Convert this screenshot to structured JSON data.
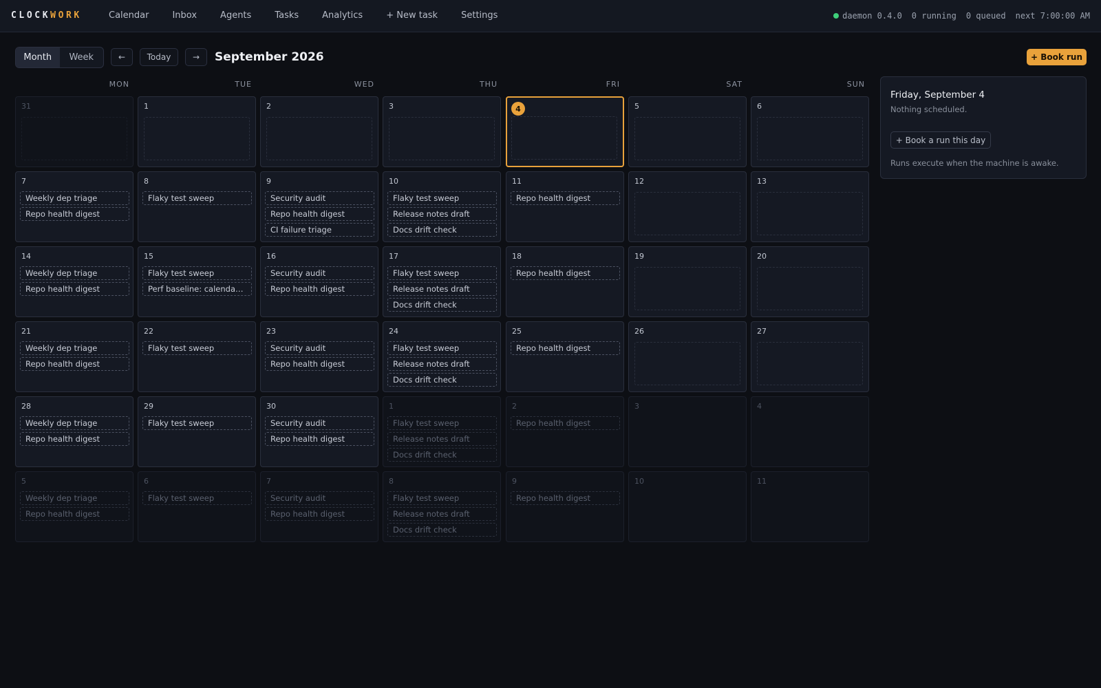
{
  "header": {
    "logo_part1": "CLOCK",
    "logo_part2": "WORK",
    "nav": [
      "Calendar",
      "Inbox",
      "Agents",
      "Tasks",
      "Analytics",
      "+ New task",
      "Settings"
    ],
    "status": {
      "daemon": "daemon 0.4.0",
      "running": "0 running",
      "queued": "0 queued",
      "next": "next 7:00:00 AM",
      "color": "#3ecf7a"
    }
  },
  "toolbar": {
    "views": [
      "Month",
      "Week"
    ],
    "active_view": "Month",
    "prev_icon": "←",
    "next_icon": "→",
    "today_label": "Today",
    "month_title": "September 2026",
    "book_label": "+ Book run"
  },
  "weekdays": [
    "MON",
    "TUE",
    "WED",
    "THU",
    "FRI",
    "SAT",
    "SUN"
  ],
  "weeks": [
    [
      {
        "day": "31",
        "other": true,
        "events": []
      },
      {
        "day": "1",
        "other": false,
        "events": []
      },
      {
        "day": "2",
        "other": false,
        "events": []
      },
      {
        "day": "3",
        "other": false,
        "events": []
      },
      {
        "day": "4",
        "other": false,
        "today": true,
        "events": []
      },
      {
        "day": "5",
        "other": false,
        "events": []
      },
      {
        "day": "6",
        "other": false,
        "events": []
      }
    ],
    [
      {
        "day": "7",
        "other": false,
        "events": [
          "Weekly dep triage",
          "Repo health digest"
        ]
      },
      {
        "day": "8",
        "other": false,
        "events": [
          "Flaky test sweep"
        ]
      },
      {
        "day": "9",
        "other": false,
        "events": [
          "Security audit",
          "Repo health digest",
          "CI failure triage"
        ]
      },
      {
        "day": "10",
        "other": false,
        "events": [
          "Flaky test sweep",
          "Release notes draft",
          "Docs drift check"
        ]
      },
      {
        "day": "11",
        "other": false,
        "events": [
          "Repo health digest"
        ]
      },
      {
        "day": "12",
        "other": false,
        "events": []
      },
      {
        "day": "13",
        "other": false,
        "events": []
      }
    ],
    [
      {
        "day": "14",
        "other": false,
        "events": [
          "Weekly dep triage",
          "Repo health digest"
        ]
      },
      {
        "day": "15",
        "other": false,
        "events": [
          "Flaky test sweep",
          "Perf baseline: calendar ..."
        ]
      },
      {
        "day": "16",
        "other": false,
        "events": [
          "Security audit",
          "Repo health digest"
        ]
      },
      {
        "day": "17",
        "other": false,
        "events": [
          "Flaky test sweep",
          "Release notes draft",
          "Docs drift check"
        ]
      },
      {
        "day": "18",
        "other": false,
        "events": [
          "Repo health digest"
        ]
      },
      {
        "day": "19",
        "other": false,
        "events": []
      },
      {
        "day": "20",
        "other": false,
        "events": []
      }
    ],
    [
      {
        "day": "21",
        "other": false,
        "events": [
          "Weekly dep triage",
          "Repo health digest"
        ]
      },
      {
        "day": "22",
        "other": false,
        "events": [
          "Flaky test sweep"
        ]
      },
      {
        "day": "23",
        "other": false,
        "events": [
          "Security audit",
          "Repo health digest"
        ]
      },
      {
        "day": "24",
        "other": false,
        "events": [
          "Flaky test sweep",
          "Release notes draft",
          "Docs drift check"
        ]
      },
      {
        "day": "25",
        "other": false,
        "events": [
          "Repo health digest"
        ]
      },
      {
        "day": "26",
        "other": false,
        "events": []
      },
      {
        "day": "27",
        "other": false,
        "events": []
      }
    ],
    [
      {
        "day": "28",
        "other": false,
        "events": [
          "Weekly dep triage",
          "Repo health digest"
        ]
      },
      {
        "day": "29",
        "other": false,
        "events": [
          "Flaky test sweep"
        ]
      },
      {
        "day": "30",
        "other": false,
        "events": [
          "Security audit",
          "Repo health digest"
        ]
      },
      {
        "day": "1",
        "other": true,
        "events": [
          "Flaky test sweep",
          "Release notes draft",
          "Docs drift check"
        ]
      },
      {
        "day": "2",
        "other": true,
        "events": [
          "Repo health digest"
        ]
      },
      {
        "day": "3",
        "other": true,
        "events": []
      },
      {
        "day": "4",
        "other": true,
        "events": []
      }
    ],
    [
      {
        "day": "5",
        "other": true,
        "events": [
          "Weekly dep triage",
          "Repo health digest"
        ]
      },
      {
        "day": "6",
        "other": true,
        "events": [
          "Flaky test sweep"
        ]
      },
      {
        "day": "7",
        "other": true,
        "events": [
          "Security audit",
          "Repo health digest"
        ]
      },
      {
        "day": "8",
        "other": true,
        "events": [
          "Flaky test sweep",
          "Release notes draft",
          "Docs drift check"
        ]
      },
      {
        "day": "9",
        "other": true,
        "events": [
          "Repo health digest"
        ]
      },
      {
        "day": "10",
        "other": true,
        "events": []
      },
      {
        "day": "11",
        "other": true,
        "events": []
      }
    ]
  ],
  "panel": {
    "title": "Friday, September 4",
    "subtitle": "Nothing scheduled.",
    "button": "+ Book a run this day",
    "note": "Runs execute when the machine is awake."
  },
  "colors": {
    "accent": "#e9a23b",
    "background": "#0d0f14",
    "cell": "#151923"
  }
}
